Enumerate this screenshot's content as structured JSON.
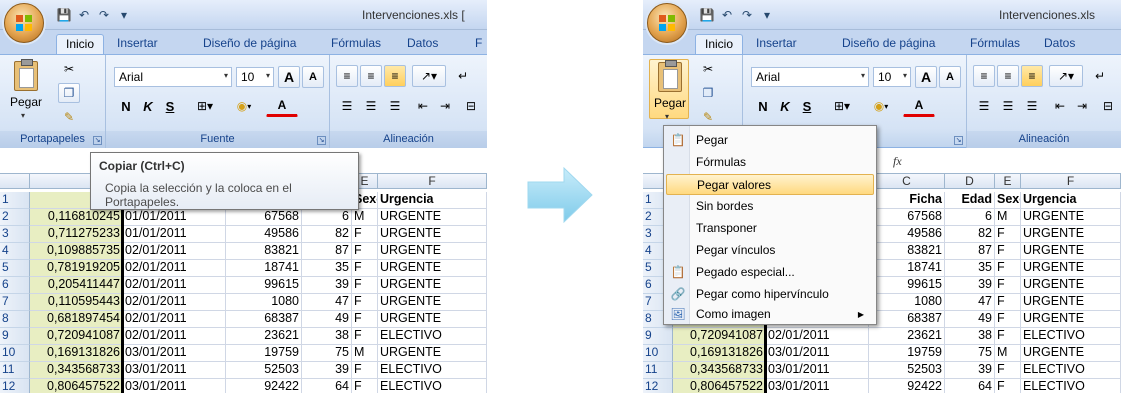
{
  "app": {
    "filename": "Intervenciones.xls",
    "filename_left": "Intervenciones.xls  [",
    "tabs": [
      "Inicio",
      "Insertar",
      "Diseño de página",
      "Fórmulas",
      "Datos",
      "F"
    ],
    "tabs_right": [
      "Inicio",
      "Insertar",
      "Diseño de página",
      "Fórmulas",
      "Datos"
    ]
  },
  "ribbon": {
    "paste_label": "Pegar",
    "font_name": "Arial",
    "font_size": "10",
    "bold": "N",
    "italic": "K",
    "underline": "S",
    "grow": "A",
    "shrink": "A",
    "font_color": "A",
    "groups": {
      "clipboard": "Portapapeles",
      "font": "Fuente",
      "alignment": "Alineación"
    }
  },
  "formula_bar": {
    "fx": "fx"
  },
  "tooltip": {
    "title": "Copiar (Ctrl+C)",
    "body_line1": "Copia la selección y la coloca en el",
    "body_line2": "Portapapeles."
  },
  "paste_menu": {
    "items": [
      {
        "label": "Pegar",
        "icon": "paste-icon",
        "highlighted": false
      },
      {
        "label": "Fórmulas",
        "icon": "",
        "highlighted": false
      },
      {
        "label": "Pegar valores",
        "icon": "",
        "highlighted": true
      },
      {
        "label": "Sin bordes",
        "icon": "",
        "highlighted": false
      },
      {
        "label": "Transponer",
        "icon": "",
        "highlighted": false
      },
      {
        "label": "Pegar vínculos",
        "icon": "",
        "highlighted": false
      },
      {
        "label": "Pegado especial...",
        "icon": "paste-special-icon",
        "highlighted": false
      },
      {
        "label": "Pegar como hipervínculo",
        "icon": "hyperlink-icon",
        "highlighted": false
      },
      {
        "label": "Como imagen",
        "icon": "picture-icon",
        "highlighted": false
      }
    ]
  },
  "sheet": {
    "left_columns": [
      "",
      "E",
      "F"
    ],
    "right_columns": [
      "C",
      "D",
      "E",
      "F"
    ],
    "header_row": {
      "C": "Ficha",
      "D": "Edad",
      "E": "Sexo",
      "F": "Urgencia"
    },
    "rows": [
      {
        "n": "1",
        "a": "",
        "b": "",
        "c": "Ficha",
        "d": "Edad",
        "e": "Sexo",
        "f": "Urgencia"
      },
      {
        "n": "2",
        "a": "0,116810245",
        "b": "01/01/2011",
        "c": "67568",
        "d": "6",
        "e": "M",
        "f": "URGENTE"
      },
      {
        "n": "3",
        "a": "0,711275233",
        "b": "01/01/2011",
        "c": "49586",
        "d": "82",
        "e": "F",
        "f": "URGENTE"
      },
      {
        "n": "4",
        "a": "0,109885735",
        "b": "02/01/2011",
        "c": "83821",
        "d": "87",
        "e": "F",
        "f": "URGENTE"
      },
      {
        "n": "5",
        "a": "0,781919205",
        "b": "02/01/2011",
        "c": "18741",
        "d": "35",
        "e": "F",
        "f": "URGENTE"
      },
      {
        "n": "6",
        "a": "0,205411447",
        "b": "02/01/2011",
        "c": "99615",
        "d": "39",
        "e": "F",
        "f": "URGENTE"
      },
      {
        "n": "7",
        "a": "0,110595443",
        "b": "02/01/2011",
        "c": "1080",
        "d": "47",
        "e": "F",
        "f": "URGENTE"
      },
      {
        "n": "8",
        "a": "0,681897454",
        "b": "02/01/2011",
        "c": "68387",
        "d": "49",
        "e": "F",
        "f": "URGENTE"
      },
      {
        "n": "9",
        "a": "0,720941087",
        "b": "02/01/2011",
        "c": "23621",
        "d": "38",
        "e": "F",
        "f": "ELECTIVO"
      },
      {
        "n": "10",
        "a": "0,169131826",
        "b": "03/01/2011",
        "c": "19759",
        "d": "75",
        "e": "M",
        "f": "URGENTE"
      },
      {
        "n": "11",
        "a": "0,343568733",
        "b": "03/01/2011",
        "c": "52503",
        "d": "39",
        "e": "F",
        "f": "ELECTIVO"
      },
      {
        "n": "12",
        "a": "0,806457522",
        "b": "03/01/2011",
        "c": "92422",
        "d": "64",
        "e": "F",
        "f": "ELECTIVO"
      }
    ]
  },
  "colors": {
    "ribbon_blue": "#c9d9ee",
    "accent_text": "#15428b",
    "column_a_fill": "#e8eec2",
    "menu_highlight": "#ffd980",
    "arrow": "#8fd3f0"
  }
}
